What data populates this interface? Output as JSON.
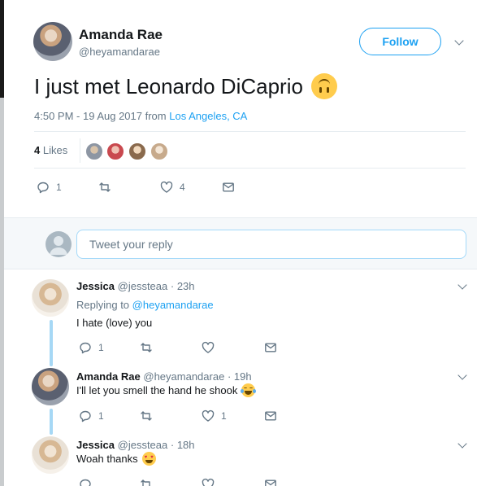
{
  "main_tweet": {
    "author_name": "Amanda Rae",
    "author_handle": "@heyamandarae",
    "follow_label": "Follow",
    "text": "I just met Leonardo DiCaprio",
    "emoji": "upside-down-face",
    "time_date": "4:50 PM - 19 Aug 2017 from",
    "location": "Los Angeles, CA",
    "likes_count": "4",
    "likes_label": "Likes",
    "actions": {
      "reply_count": "1",
      "retweet_count": "",
      "like_count": "4"
    }
  },
  "reply_box": {
    "placeholder": "Tweet your reply"
  },
  "replies": [
    {
      "author_name": "Jessica",
      "author_handle": "@jessteaa",
      "time": "· 23h",
      "replying_prefix": "Replying to",
      "replying_to": "@heyamandarae",
      "text": "I hate (love) you",
      "reply_count": "1",
      "retweet_count": "",
      "like_count": ""
    },
    {
      "author_name": "Amanda Rae",
      "author_handle": "@heyamandarae",
      "time": "· 19h",
      "text": "I'll let you smell the hand he shook",
      "emoji": "face-with-tears-of-joy",
      "reply_count": "1",
      "retweet_count": "",
      "like_count": "1"
    },
    {
      "author_name": "Jessica",
      "author_handle": "@jessteaa",
      "time": "· 18h",
      "text": "Woah thanks",
      "emoji": "heart-eyes",
      "reply_count": "",
      "retweet_count": "",
      "like_count": ""
    }
  ],
  "colors": {
    "accent": "#1da1f2",
    "text": "#14171a",
    "muted": "#657786",
    "divider": "#e6ecf0",
    "thread_line": "#a6d8f5"
  }
}
